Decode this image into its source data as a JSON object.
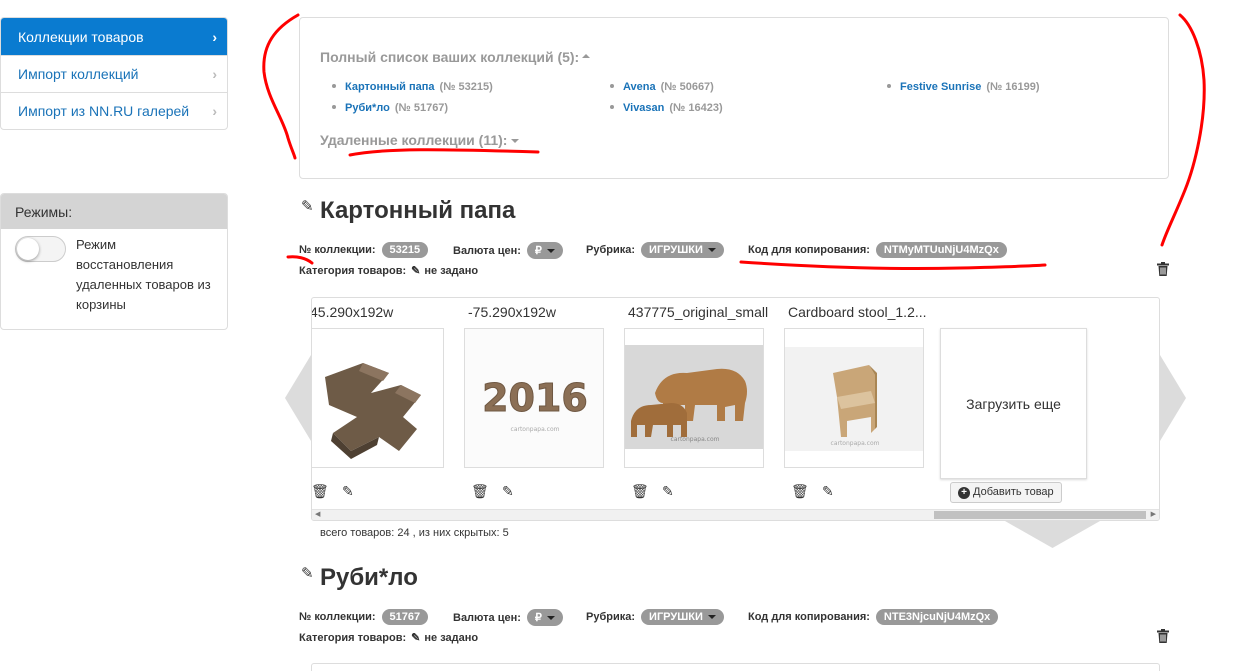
{
  "sidebar": {
    "items": [
      {
        "label": "Коллекции товаров"
      },
      {
        "label": "Импорт коллекций"
      },
      {
        "label": "Импорт из NN.RU галерей"
      }
    ]
  },
  "modes": {
    "title": "Режимы:",
    "toggle_label": "Режим восстановления удаленных товаров из корзины",
    "toggle_on": false
  },
  "collections_list": {
    "title": "Полный список ваших коллекций (5):",
    "items": [
      {
        "name": "Картонный папа",
        "number": "(№ 53215)"
      },
      {
        "name": "Руби*ло",
        "number": "(№ 51767)"
      },
      {
        "name": "Avena",
        "number": "(№ 50667)"
      },
      {
        "name": "Vivasan",
        "number": "(№ 16423)"
      },
      {
        "name": "Festive Sunrise",
        "number": "(№ 16199)"
      }
    ],
    "deleted": "Удаленные коллекции (11):"
  },
  "blocks": [
    {
      "title": "Картонный папа",
      "number_label": "№ коллекции:",
      "number": "53215",
      "currency_label": "Валюта цен:",
      "currency": "₽",
      "rubric_label": "Рубрика:",
      "rubric": "ИГРУШКИ",
      "code_label": "Код для копирования:",
      "code": "NTMyMTUuNjU4MzQx",
      "category_label": "Категория товаров:",
      "category": "не задано",
      "products": [
        {
          "caption": "45.290x192w"
        },
        {
          "caption": "-75.290x192w"
        },
        {
          "caption": "437775_original_small"
        },
        {
          "caption": "Cardboard stool_1.2..."
        }
      ],
      "load_more": "Загрузить еще",
      "add_product": "Добавить товар",
      "totals": "всего товаров: 24 , из них скрытых: 5"
    },
    {
      "title": "Руби*ло",
      "number_label": "№ коллекции:",
      "number": "51767",
      "currency_label": "Валюта цен:",
      "currency": "₽",
      "rubric_label": "Рубрика:",
      "rubric": "ИГРУШКИ",
      "code_label": "Код для копирования:",
      "code": "NTE3NjcuNjU4MzQx",
      "category_label": "Категория товаров:",
      "category": "не задано"
    }
  ],
  "images": {
    "img2_text": "2016",
    "watermark": "cartonpapa.com"
  },
  "colors": {
    "accent": "#0a7bd0",
    "link": "#1a73b8",
    "badge": "#999999",
    "annotation": "#ff0000",
    "cardboard": "#a67c52"
  }
}
